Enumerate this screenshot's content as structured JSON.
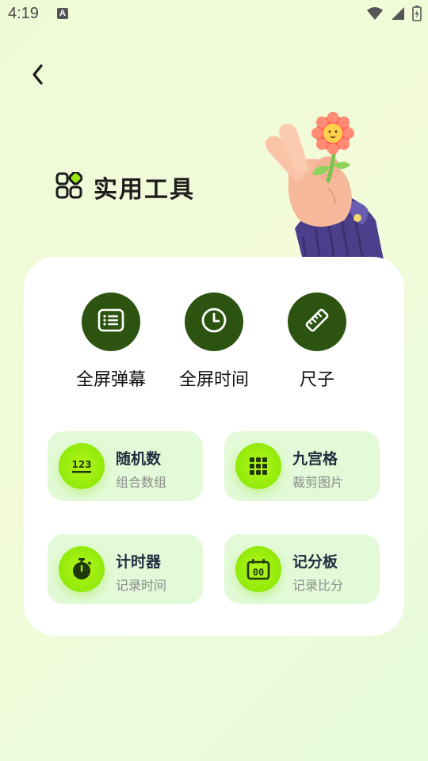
{
  "status_bar": {
    "time": "4:19",
    "notification_badge": "A"
  },
  "header": {
    "back_icon": "chevron-left-icon",
    "title": "实用工具",
    "title_icon": "apps-grid-icon"
  },
  "colors": {
    "quick_circle": "#2c5410",
    "tool_card_bg": "#e2fad7",
    "tool_icon_green": "#9bed0f",
    "card_bg": "#ffffff"
  },
  "quick_actions": [
    {
      "label": "全屏弹幕",
      "icon": "text-box-icon"
    },
    {
      "label": "全屏时间",
      "icon": "clock-icon"
    },
    {
      "label": "尺子",
      "icon": "ruler-icon"
    }
  ],
  "tools": [
    {
      "title": "随机数",
      "subtitle": "组合数组",
      "icon": "numbers-icon",
      "icon_text": "123"
    },
    {
      "title": "九宫格",
      "subtitle": "裁剪图片",
      "icon": "grid-nine-icon"
    },
    {
      "title": "计时器",
      "subtitle": "记录时间",
      "icon": "stopwatch-icon"
    },
    {
      "title": "记分板",
      "subtitle": "记录比分",
      "icon": "scoreboard-icon",
      "icon_text": "00"
    }
  ]
}
